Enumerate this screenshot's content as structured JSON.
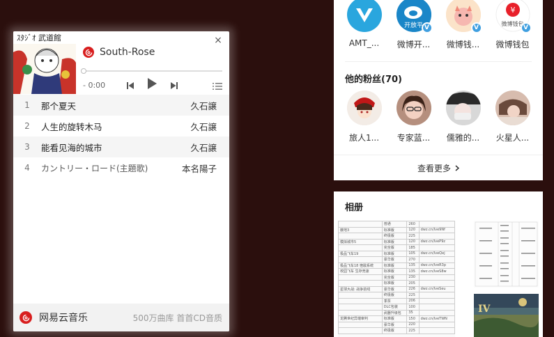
{
  "player": {
    "song_title": "South-Rose",
    "close_label": "×",
    "time": "- 0:00",
    "tracks": [
      {
        "num": "1",
        "name": "那个夏天",
        "artist": "久石譲"
      },
      {
        "num": "2",
        "name": "人生的旋转木马",
        "artist": "久石譲"
      },
      {
        "num": "3",
        "name": "能看见海的城市",
        "artist": "久石譲"
      },
      {
        "num": "4",
        "name": "カントリー・ロード(主題歌)",
        "artist": "本名陽子"
      }
    ],
    "progress": 0,
    "footer": {
      "brand": "网易云音乐",
      "slogan": "500万曲库 首首CD音质"
    }
  },
  "social": {
    "following": [
      {
        "name": "AMT_...",
        "icon": "v-logo-icon",
        "verified": false
      },
      {
        "name": "微博开...",
        "icon": "weibo-open-icon",
        "verified": true,
        "overlay": "开放平"
      },
      {
        "name": "微博钱...",
        "icon": "weibo-wallet-mascot-icon",
        "verified": true
      },
      {
        "name": "微博钱包",
        "icon": "weibo-wallet-yen-icon",
        "verified": true,
        "overlay": "微博钱包"
      }
    ],
    "fans_title": "他的粉丝(70)",
    "fans": [
      {
        "name": "旅人1..."
      },
      {
        "name": "专家蓝..."
      },
      {
        "name": "儒雅的..."
      },
      {
        "name": "火星人..."
      }
    ],
    "see_more": "查看更多",
    "verified_mark": "V"
  },
  "album": {
    "title": "相册",
    "table_rows": [
      [
        "",
        "普通",
        "260",
        ""
      ],
      [
        "蔽地3",
        "标准版",
        "120",
        "dwz.cn/Ive9Nf"
      ],
      [
        "",
        "终极版",
        "225",
        ""
      ],
      [
        "模拟城市5",
        "标准版",
        "120",
        "dwz.cn/IveP9z"
      ],
      [
        "",
        "完全版",
        "185",
        ""
      ],
      [
        "极品飞车19",
        "标准版",
        "105",
        "dwz.cn/IveQej"
      ],
      [
        "",
        "豪华版",
        "270",
        ""
      ],
      [
        "极品飞车18 宿敌系统",
        "标准版",
        "135",
        "dwz.cn/IveR3p"
      ],
      [
        "校园飞车 生存竞速",
        "标准版",
        "135",
        "dwz.cn/IveS8w"
      ],
      [
        "",
        "完全版",
        "230",
        ""
      ],
      [
        "",
        "标准版",
        "205",
        ""
      ],
      [
        "星球大战: 战争前线",
        "豪华版",
        "226",
        "dwz.cn/IveSeu"
      ],
      [
        "",
        "终极版",
        "225",
        ""
      ],
      [
        "",
        "季票",
        "206",
        ""
      ],
      [
        "",
        "DLC包装",
        "100",
        ""
      ],
      [
        "",
        "武器升级包",
        "35",
        ""
      ],
      [
        "龙腾世纪异端审判",
        "标准版",
        "150",
        "dwz.cn/IveTWN"
      ],
      [
        "",
        "豪华版",
        "220",
        ""
      ],
      [
        "",
        "终极版",
        "225",
        ""
      ]
    ]
  }
}
